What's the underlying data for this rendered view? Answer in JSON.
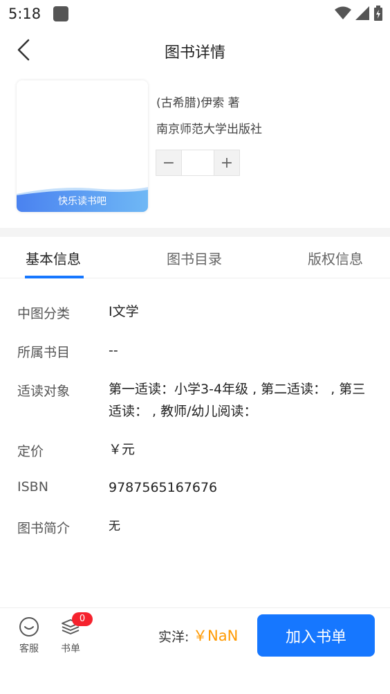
{
  "status_bar": {
    "time": "5:18",
    "icons": [
      "wifi-icon",
      "signal-icon",
      "battery-icon"
    ]
  },
  "header": {
    "title": "图书详情",
    "back_icon": "chevron-left-icon"
  },
  "book": {
    "cover_label": "快乐读书吧",
    "author": "(古希腊)伊索 著",
    "publisher": "南京师范大学出版社",
    "quantity_value": "",
    "minus_label": "−",
    "plus_label": "+"
  },
  "tabs": [
    {
      "label": "基本信息",
      "active": true
    },
    {
      "label": "图书目录",
      "active": false
    },
    {
      "label": "版权信息",
      "active": false
    }
  ],
  "info": [
    {
      "label": "中图分类",
      "value": "I文学"
    },
    {
      "label": "所属书目",
      "value": "--"
    },
    {
      "label": "适读对象",
      "value": "第一适读：小学3-4年级 , 第二适读：  , 第三适读：  , 教师/幼儿阅读："
    },
    {
      "label": "定价",
      "value": "￥元"
    },
    {
      "label": "ISBN",
      "value": "9787565167676"
    },
    {
      "label": "图书简介",
      "value": "无"
    }
  ],
  "bottom_bar": {
    "service_label": "客服",
    "booklist_label": "书单",
    "booklist_badge": "0",
    "price_label": "实洋:",
    "price_value": "￥NaN",
    "add_button_label": "加入书单"
  },
  "colors": {
    "accent": "#1677ff",
    "price": "#ff9900",
    "badge": "#f5222d"
  }
}
